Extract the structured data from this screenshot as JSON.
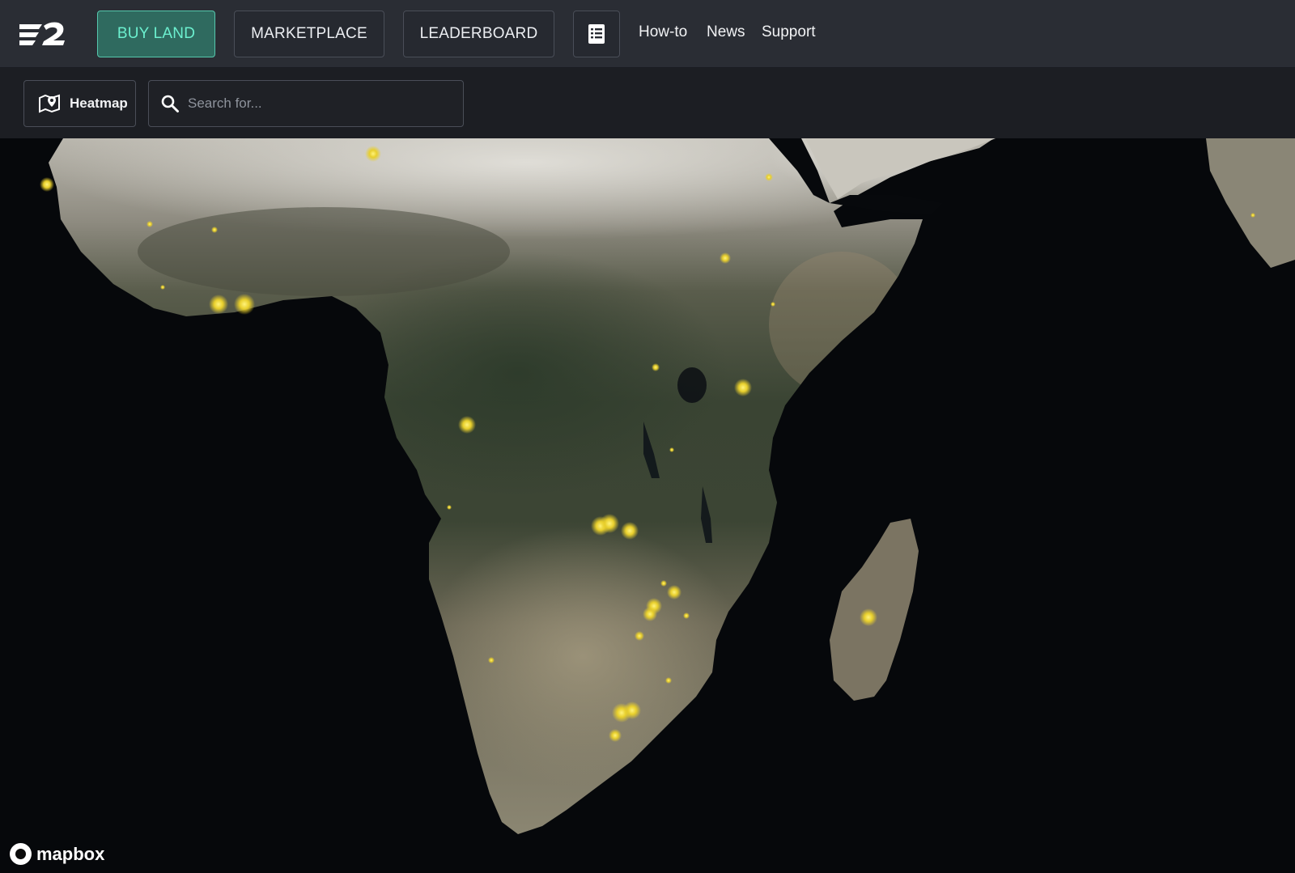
{
  "header": {
    "logo": "e2-logo",
    "buttons": [
      {
        "label": "BUY LAND",
        "active": true
      },
      {
        "label": "MARKETPLACE",
        "active": false
      },
      {
        "label": "LEADERBOARD",
        "active": false
      }
    ],
    "doc_icon": "document-list-icon",
    "links": [
      "How-to",
      "News",
      "Support"
    ]
  },
  "toolbar": {
    "heatmap_label": "Heatmap",
    "heatmap_icon": "map-pin-icon",
    "search_icon": "search-icon",
    "search_placeholder": "Search for...",
    "search_value": ""
  },
  "map": {
    "style": "satellite-dark",
    "region": "Africa",
    "highlight_color": "#ffe94a",
    "attribution": "mapbox"
  },
  "colors": {
    "accent": "#6cf0cf",
    "accent_bg": "#2f6a5f",
    "topbar": "#2a2d34",
    "subbar": "#1c1e23"
  }
}
